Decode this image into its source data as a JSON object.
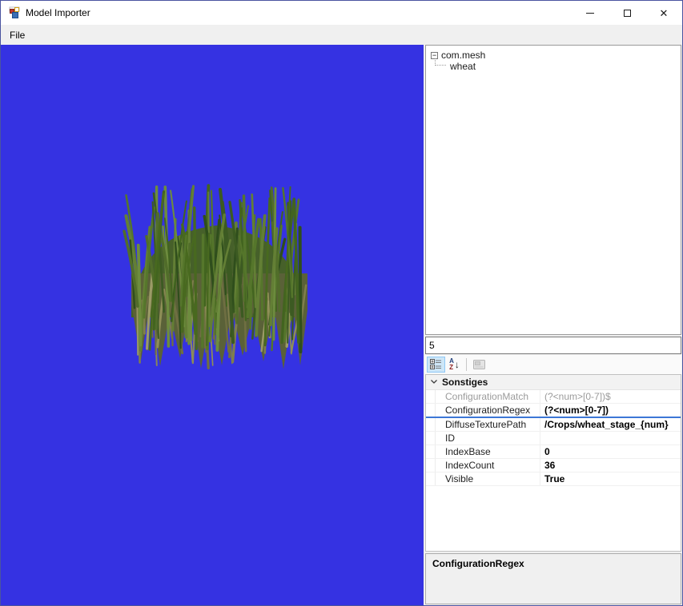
{
  "window": {
    "title": "Model Importer",
    "controls": {
      "close_glyph": "✕"
    }
  },
  "menu": {
    "items": [
      {
        "label": "File"
      }
    ]
  },
  "viewport": {
    "background_color": "#3532E2",
    "model_name": "wheat"
  },
  "tree": {
    "collapse_glyph": "−",
    "root": "com.mesh",
    "children": [
      "wheat"
    ]
  },
  "index_box": {
    "value": "5"
  },
  "property_grid": {
    "toolbar": {
      "buttons": [
        "categorized",
        "alphabetical-sort",
        "property-pages"
      ]
    },
    "category": "Sonstiges",
    "rows": [
      {
        "name": "ConfigurationMatch",
        "value": "(?<num>[0-7])$",
        "readonly": true,
        "bold": false,
        "selected": false
      },
      {
        "name": "ConfigurationRegex",
        "value": "(?<num>[0-7])",
        "readonly": false,
        "bold": true,
        "selected": true
      },
      {
        "name": "DiffuseTexturePath",
        "value": "/Crops/wheat_stage_{num}",
        "readonly": false,
        "bold": true,
        "selected": false
      },
      {
        "name": "ID",
        "value": "",
        "readonly": false,
        "bold": false,
        "selected": false
      },
      {
        "name": "IndexBase",
        "value": "0",
        "readonly": false,
        "bold": true,
        "selected": false
      },
      {
        "name": "IndexCount",
        "value": "36",
        "readonly": false,
        "bold": true,
        "selected": false
      },
      {
        "name": "Visible",
        "value": "True",
        "readonly": false,
        "bold": true,
        "selected": false
      }
    ],
    "help": {
      "title": "ConfigurationRegex"
    }
  }
}
